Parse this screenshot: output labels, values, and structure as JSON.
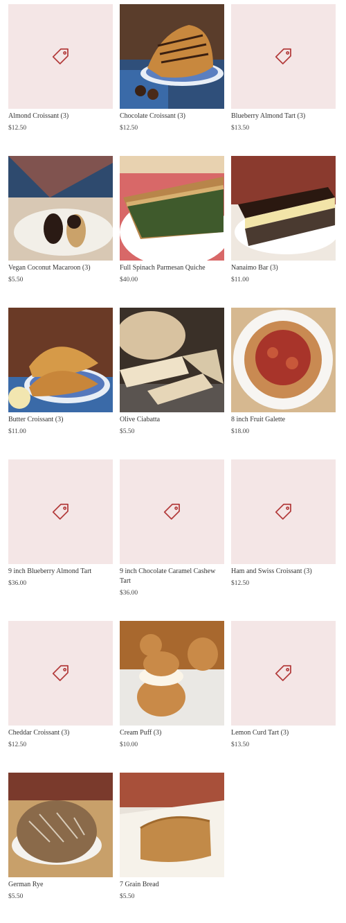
{
  "colors": {
    "placeholder_bg": "#f4e6e6",
    "placeholder_icon": "#b23a3a"
  },
  "products": [
    {
      "name": "Almond Croissant (3)",
      "price": "$12.50",
      "image": "placeholder"
    },
    {
      "name": "Chocolate Croissant (3)",
      "price": "$12.50",
      "image": "chocolate-croissant"
    },
    {
      "name": "Blueberry Almond Tart (3)",
      "price": "$13.50",
      "image": "placeholder"
    },
    {
      "name": "Vegan Coconut Macaroon (3)",
      "price": "$5.50",
      "image": "macaroon"
    },
    {
      "name": "Full Spinach Parmesan Quiche",
      "price": "$40.00",
      "image": "quiche"
    },
    {
      "name": "Nanaimo Bar (3)",
      "price": "$11.00",
      "image": "nanaimo"
    },
    {
      "name": "Butter Croissant (3)",
      "price": "$11.00",
      "image": "butter-croissant"
    },
    {
      "name": "Olive Ciabatta",
      "price": "$5.50",
      "image": "ciabatta"
    },
    {
      "name": "8 inch Fruit Galette",
      "price": "$18.00",
      "image": "galette"
    },
    {
      "name": "9 inch Blueberry Almond Tart",
      "price": "$36.00",
      "image": "placeholder"
    },
    {
      "name": "9 inch Chocolate Caramel Cashew Tart",
      "price": "$36.00",
      "image": "placeholder"
    },
    {
      "name": "Ham and Swiss Croissant (3)",
      "price": "$12.50",
      "image": "placeholder"
    },
    {
      "name": "Cheddar Croissant (3)",
      "price": "$12.50",
      "image": "placeholder"
    },
    {
      "name": "Cream Puff (3)",
      "price": "$10.00",
      "image": "cream-puff"
    },
    {
      "name": "Lemon Curd Tart (3)",
      "price": "$13.50",
      "image": "placeholder"
    },
    {
      "name": "German Rye",
      "price": "$5.50",
      "image": "german-rye"
    },
    {
      "name": "7 Grain Bread",
      "price": "$5.50",
      "image": "grain-bread"
    }
  ]
}
